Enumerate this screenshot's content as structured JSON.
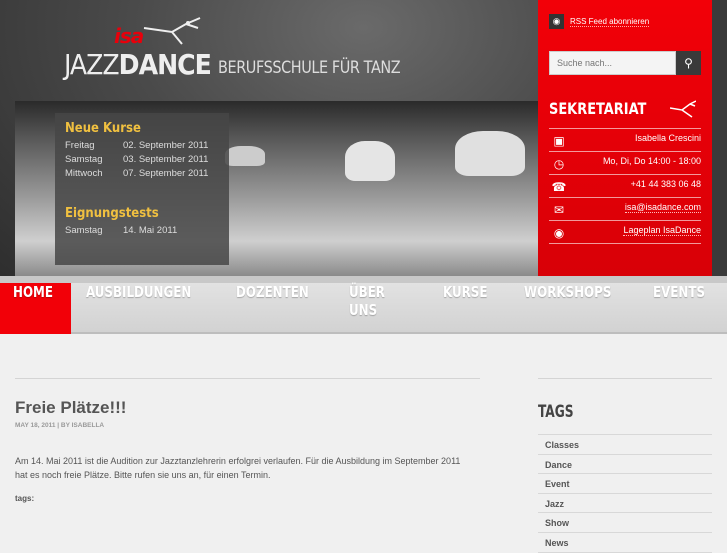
{
  "header": {
    "logo_isa": "isa",
    "logo_jazz": "JAZZ",
    "logo_dance": "DANCE",
    "tagline": "BERUFSSCHULE FÜR TANZ"
  },
  "info": {
    "neue_kurse_title": "Neue Kurse",
    "kurse": [
      {
        "day": "Freitag",
        "date": "02. September 2011"
      },
      {
        "day": "Samstag",
        "date": "03. September 2011"
      },
      {
        "day": "Mittwoch",
        "date": "07. September 2011"
      }
    ],
    "eignung_title": "Eignungstests",
    "eignung": [
      {
        "day": "Samstag",
        "date": "14. Mai 2011"
      }
    ]
  },
  "sidebar": {
    "rss_label": "RSS Feed abonnieren",
    "search_placeholder": "Suche nach...",
    "sekretariat_title": "SEKRETARIAT",
    "contacts": [
      {
        "icon": "id-card-icon",
        "text": "Isabella Crescini"
      },
      {
        "icon": "clock-icon",
        "text": "Mo, Di, Do 14:00 - 18:00"
      },
      {
        "icon": "phone-icon",
        "text": "+41 44 383 06 48"
      },
      {
        "icon": "mail-icon",
        "text": "isa@isadance.com"
      },
      {
        "icon": "eye-icon",
        "text": "Lageplan IsaDance"
      }
    ]
  },
  "nav": [
    "HOME",
    "AUSBILDUNGEN",
    "DOZENTEN",
    "ÜBER UNS",
    "KURSE",
    "WORKSHOPS",
    "EVENTS"
  ],
  "post": {
    "title": "Freie Plätze!!!",
    "meta": "MAY 18, 2011 | BY ISABELLA",
    "body": "Am 14. Mai 2011 ist die Audition zur Jazztanzlehrerin erfolgrei verlaufen. Für die Ausbildung im September 2011 hat es noch freie Plätze. Bitte rufen sie uns an, für einen Termin.",
    "tags_label": "tags:"
  },
  "tags": {
    "title": "TAGS",
    "items": [
      "Classes",
      "Dance",
      "Event",
      "Jazz",
      "Show",
      "News"
    ]
  },
  "colors": {
    "accent": "#f20008",
    "heading_yellow": "#f0c040"
  }
}
